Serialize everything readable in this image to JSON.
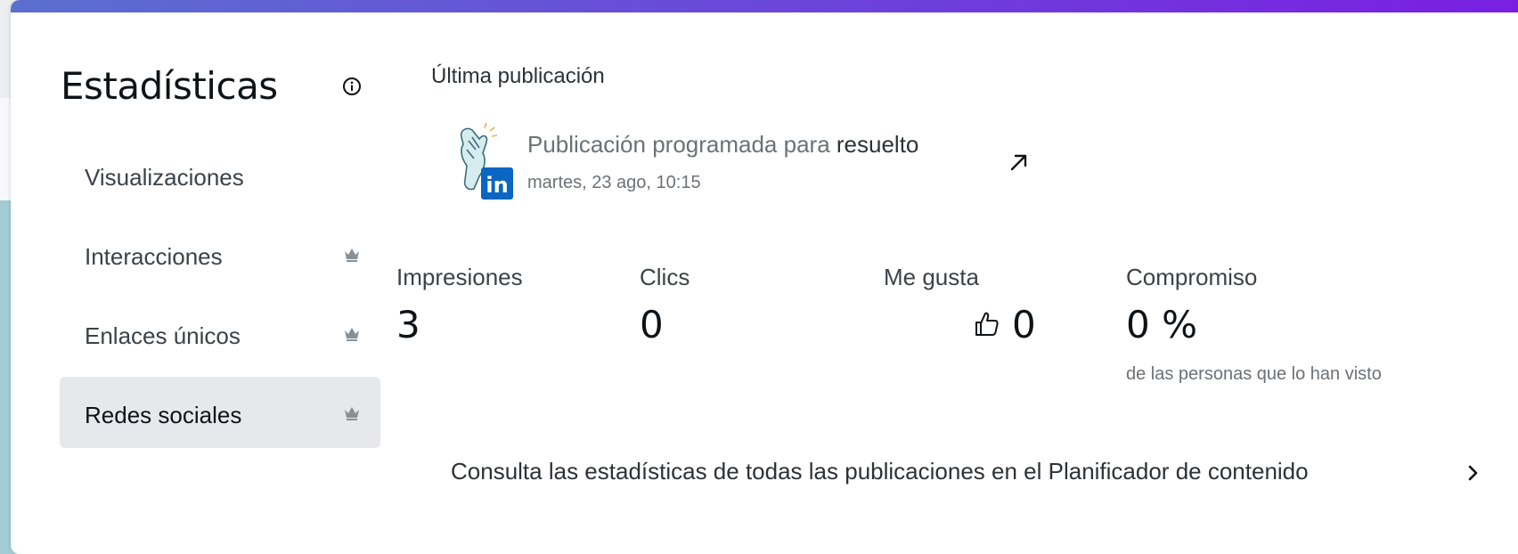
{
  "header": {
    "title": "Estadísticas",
    "info_icon": "info-circle-icon"
  },
  "sidebar": {
    "items": [
      {
        "label": "Visualizaciones",
        "premium": false,
        "active": false
      },
      {
        "label": "Interacciones",
        "premium": true,
        "active": false
      },
      {
        "label": "Enlaces únicos",
        "premium": true,
        "active": false
      },
      {
        "label": "Redes sociales",
        "premium": true,
        "active": true
      }
    ],
    "premium_icon": "crown-icon"
  },
  "latest_post": {
    "section_title": "Última publicación",
    "title_prefix": "Publicación programada para",
    "title_target": "resuelto",
    "date": "martes, 23 ago, 10:15",
    "network": "in",
    "open_icon": "arrow-up-right-icon"
  },
  "stats": [
    {
      "label": "Impresiones",
      "value": "3"
    },
    {
      "label": "Clics",
      "value": "0"
    },
    {
      "label": "Me gusta",
      "value": "0",
      "icon": "thumbs-up-icon"
    },
    {
      "label": "Compromiso",
      "value": "0 %",
      "note": "de las personas que lo han visto"
    }
  ],
  "footer": {
    "link_label": "Consulta las estadísticas de todas las publicaciones en el Planificador de contenido"
  },
  "colors": {
    "top_gradient_start": "#5b6fd0",
    "top_gradient_end": "#7a1fe0",
    "linkedin_blue": "#0a66c2",
    "active_item_bg": "#e7e8ec"
  }
}
